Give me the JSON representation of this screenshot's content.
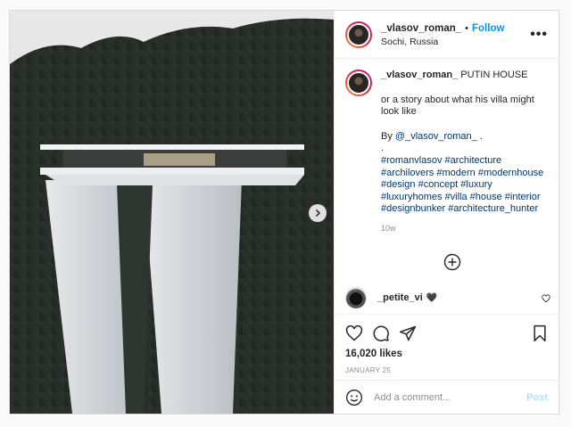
{
  "post": {
    "username": "_vlasov_roman_",
    "bullet": "•",
    "follow_label": "Follow",
    "location": "Sochi, Russia",
    "more_label": "•••"
  },
  "caption": {
    "username": "_vlasov_roman_",
    "title": "PUTIN HOUSE",
    "line1": "or a story about what his villa might look like",
    "by_prefix": "By ",
    "mention": "@_vlasov_roman_",
    "by_suffix": " .",
    "dot": ".",
    "hashtags_line1": "#romanvlasov #architecture",
    "hashtags_line2": "#archilovers #modern #modernhouse",
    "hashtags_line3": "#design #concept #luxury",
    "hashtags_line4": "#luxuryhomes #villa #house #interior",
    "hashtags_line5": "#designbunker #architecture_hunter",
    "time": "10w"
  },
  "comments": [
    {
      "username": "_petite_vi",
      "text": "🖤"
    }
  ],
  "actions": {
    "likes": "16,020 likes",
    "date": "JANUARY 25"
  },
  "add_comment": {
    "placeholder": "Add a comment...",
    "post_label": "Post"
  },
  "carousel": {
    "current": 1,
    "total": 1
  },
  "colors": {
    "link": "#0095f6",
    "hashtag": "#00376b",
    "muted": "#8e8e8e",
    "post_disabled": "#b2dffc"
  },
  "icons": [
    "chevron-right-icon",
    "plus-circle-icon",
    "heart-icon",
    "comment-icon",
    "share-icon",
    "bookmark-icon",
    "emoji-icon",
    "more-icon"
  ]
}
